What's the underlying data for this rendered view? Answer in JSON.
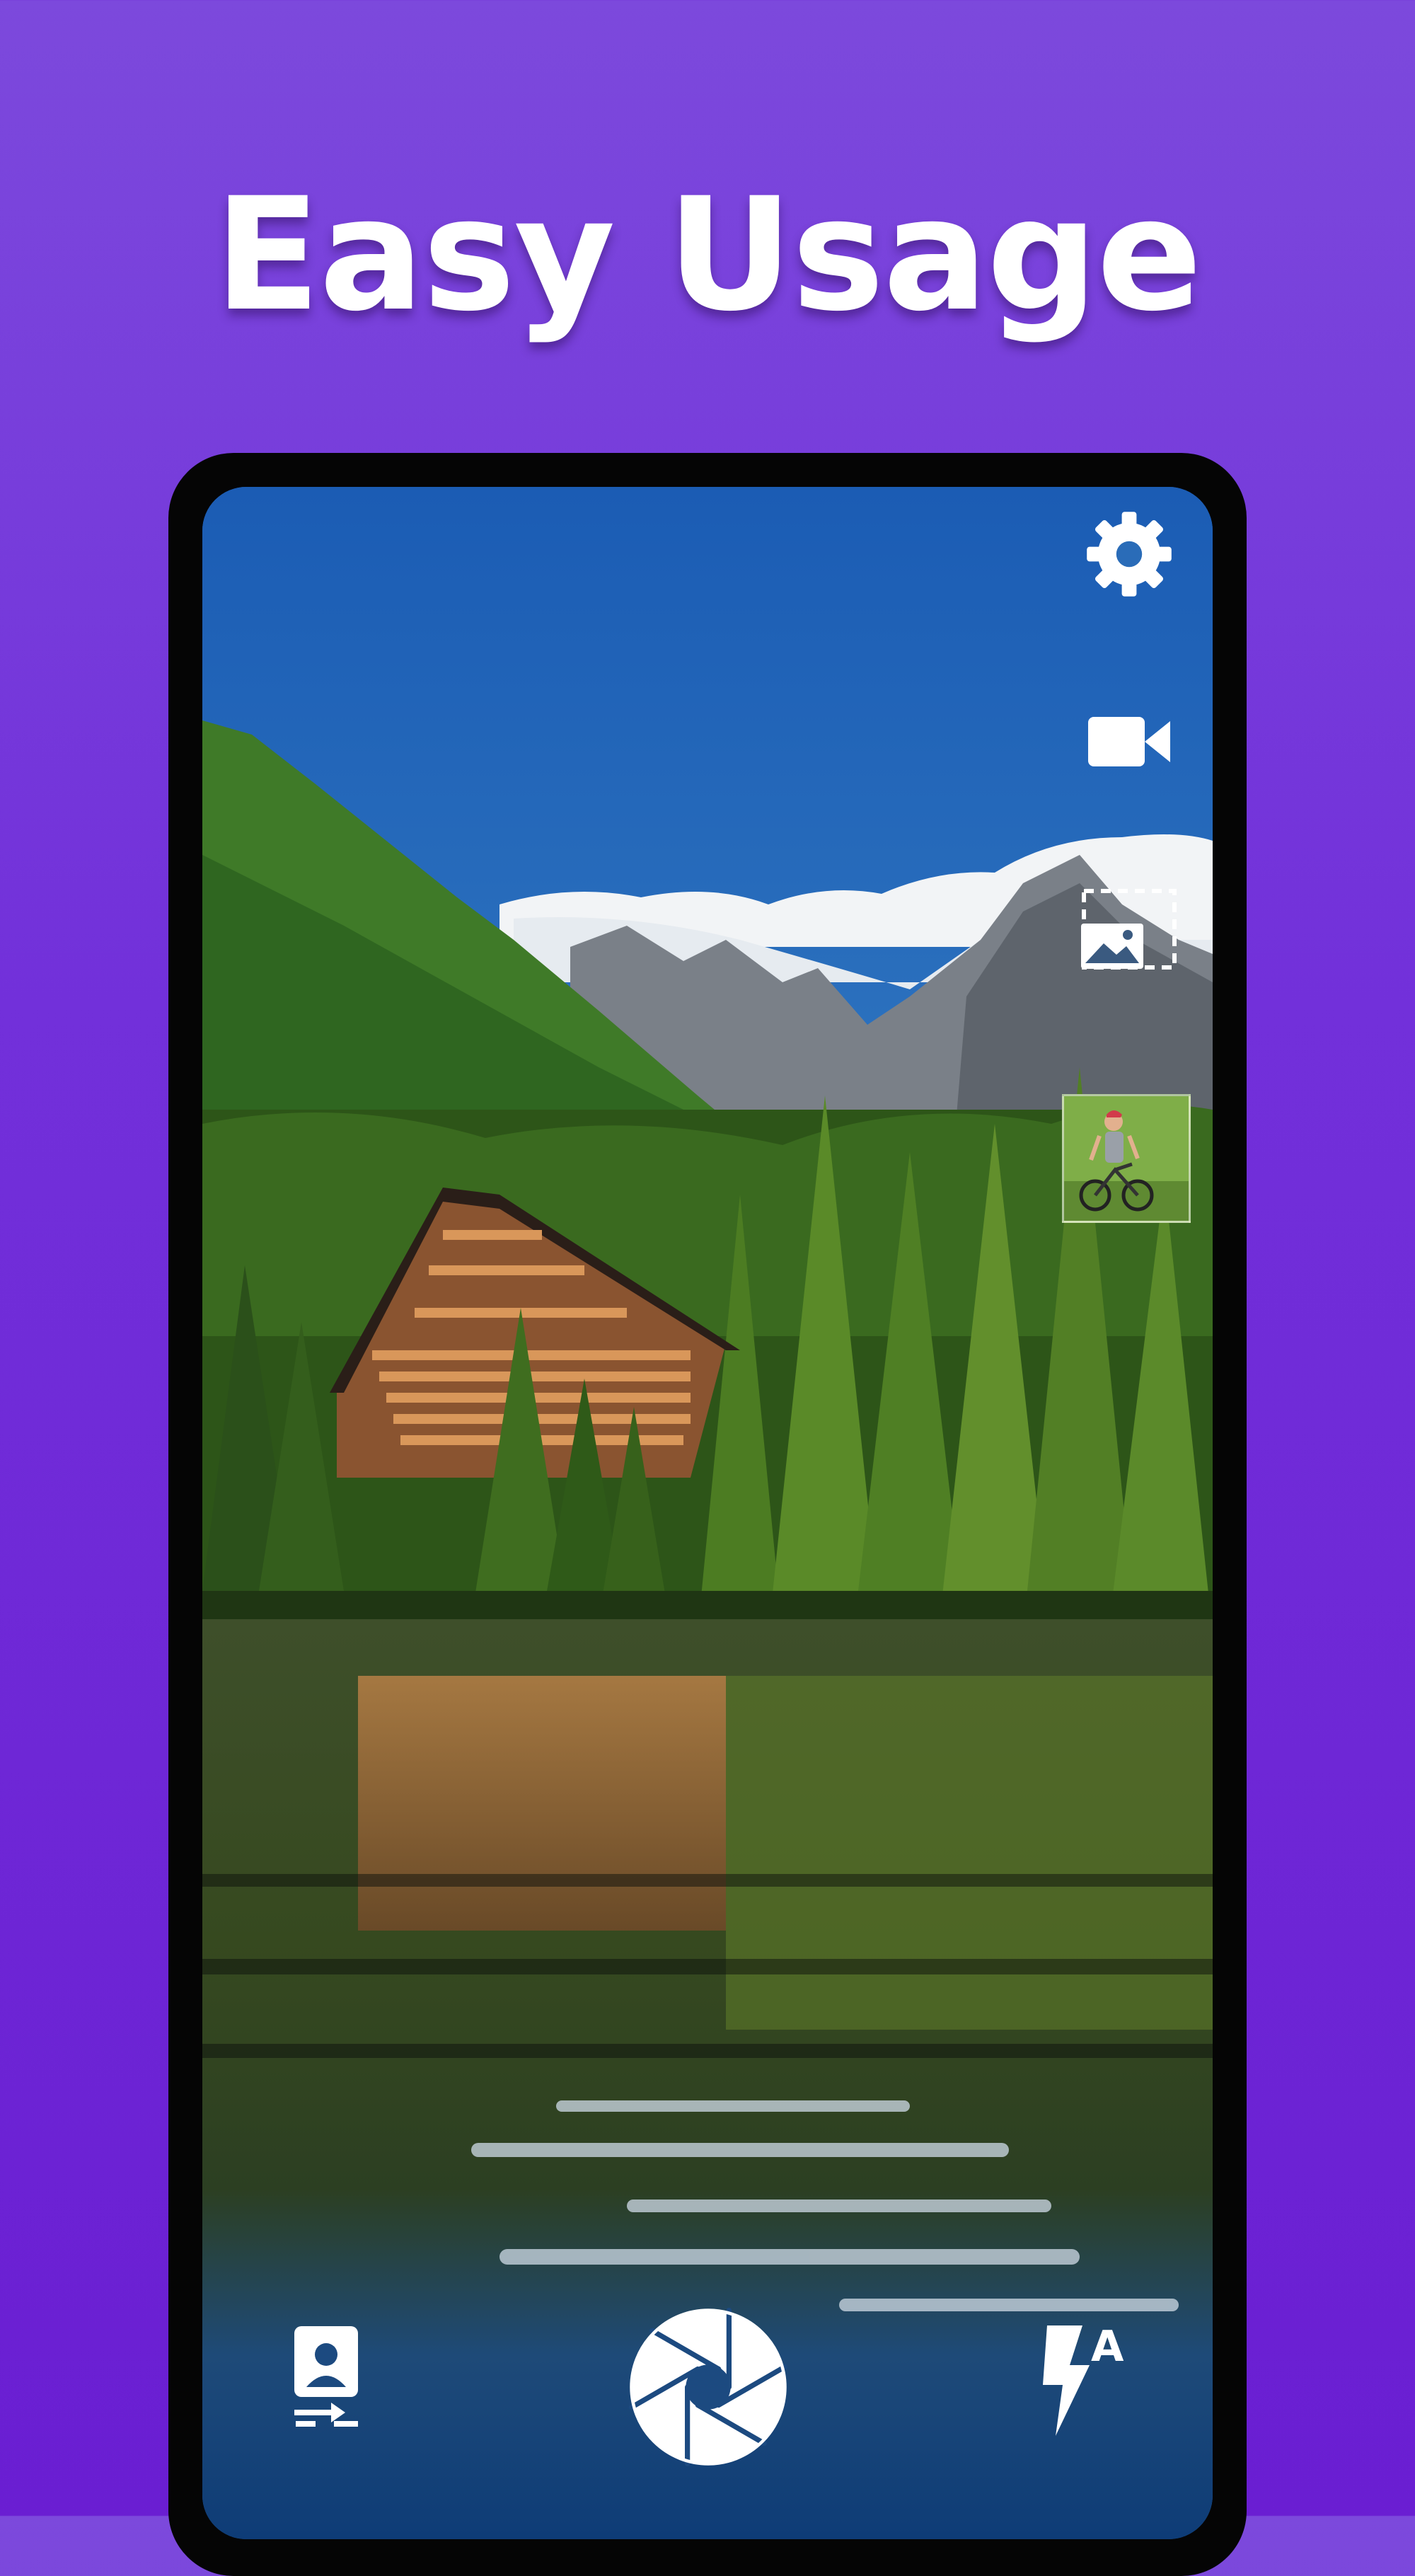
{
  "headline": "Easy Usage",
  "colors": {
    "background_top": "#7c49dc",
    "background_bottom": "#6a1ed2",
    "phone_frame": "#050505",
    "icon": "#ffffff"
  },
  "camera": {
    "top_icons": [
      "gear-icon",
      "video-camera-icon",
      "gallery-icon"
    ],
    "thumbnail": "last-photo-thumbnail",
    "bottom_icons": [
      "switch-camera-icon",
      "shutter-icon",
      "flash-auto-icon"
    ],
    "flash_mode_label": "A"
  }
}
